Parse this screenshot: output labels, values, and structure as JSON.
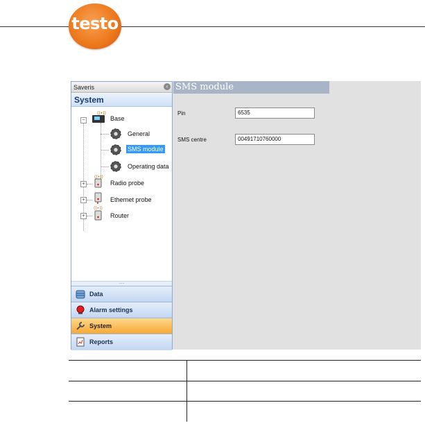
{
  "brand": {
    "logo_text": "testo",
    "logo_color": "#ee7a1e"
  },
  "window": {
    "panel_title": "Saveris",
    "section_title": "System"
  },
  "tree": {
    "base": "Base",
    "general": "General",
    "sms_module": "SMS module",
    "operating_data": "Operating data",
    "radio_probe": "Radio probe",
    "ethernet_probe": "Ethernet probe",
    "router": "Router",
    "selected": "SMS module"
  },
  "nav": {
    "data": "Data",
    "alarm_settings": "Alarm settings",
    "system": "System",
    "reports": "Reports",
    "active": "System"
  },
  "content": {
    "title": "SMS module",
    "pin_label": "Pin",
    "pin_value": "6535",
    "sms_centre_label": "SMS centre",
    "sms_centre_value": "00491710760000"
  },
  "colors": {
    "selection": "#3399ff",
    "active_nav": "#f7a836",
    "header_blue": "#1d3b6e"
  }
}
